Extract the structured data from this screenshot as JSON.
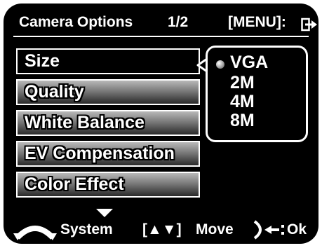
{
  "header": {
    "title": "Camera Options",
    "page": "1/2",
    "menu_label": "[MENU]:",
    "exit_icon": "exit-arrow-icon"
  },
  "menu": {
    "items": [
      {
        "label": "Size",
        "selected": true
      },
      {
        "label": "Quality",
        "selected": false
      },
      {
        "label": "White Balance",
        "selected": false
      },
      {
        "label": "EV Compensation",
        "selected": false
      },
      {
        "label": "Color Effect",
        "selected": false
      }
    ]
  },
  "size_options": {
    "items": [
      "VGA",
      "2M",
      "4M",
      "8M"
    ],
    "selected": "VGA"
  },
  "footer": {
    "system_label": "System",
    "move_keys": "[▲▼]",
    "move_label": "Move",
    "ok_label": "Ok"
  },
  "colors": {
    "background": "#000000",
    "text": "#ffffff",
    "item_gradient_top": "#b9b9b9",
    "item_gradient_bottom": "#2a2a2a"
  }
}
